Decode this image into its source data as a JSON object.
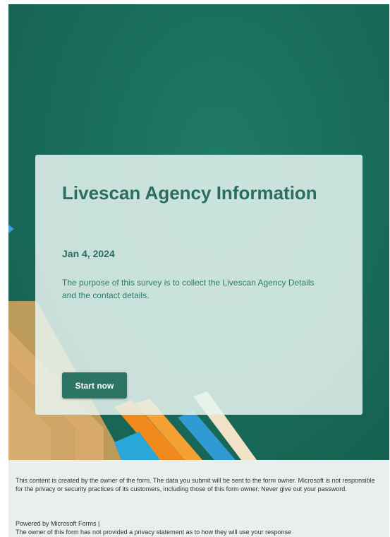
{
  "form": {
    "title": "Livescan Agency Information",
    "date": "Jan 4, 2024",
    "description": "The purpose of this survey is to collect the Livescan Agency Details and the contact details.",
    "start_label": "Start now"
  },
  "footer": {
    "notice": "This content is created by the owner of the form. The data you submit will be sent to the form owner. Microsoft is not responsible for the privacy or security practices of its customers, including those of this form owner. Never give out your password.",
    "powered_by": "Powered by Microsoft Forms |",
    "privacy": "The owner of this form has not provided a privacy statement as to how they will use your response"
  },
  "colors": {
    "background_green": "#1a6d5b",
    "accent": "#2c7463",
    "card": "#e6f4f0",
    "footer": "#e9efee"
  }
}
